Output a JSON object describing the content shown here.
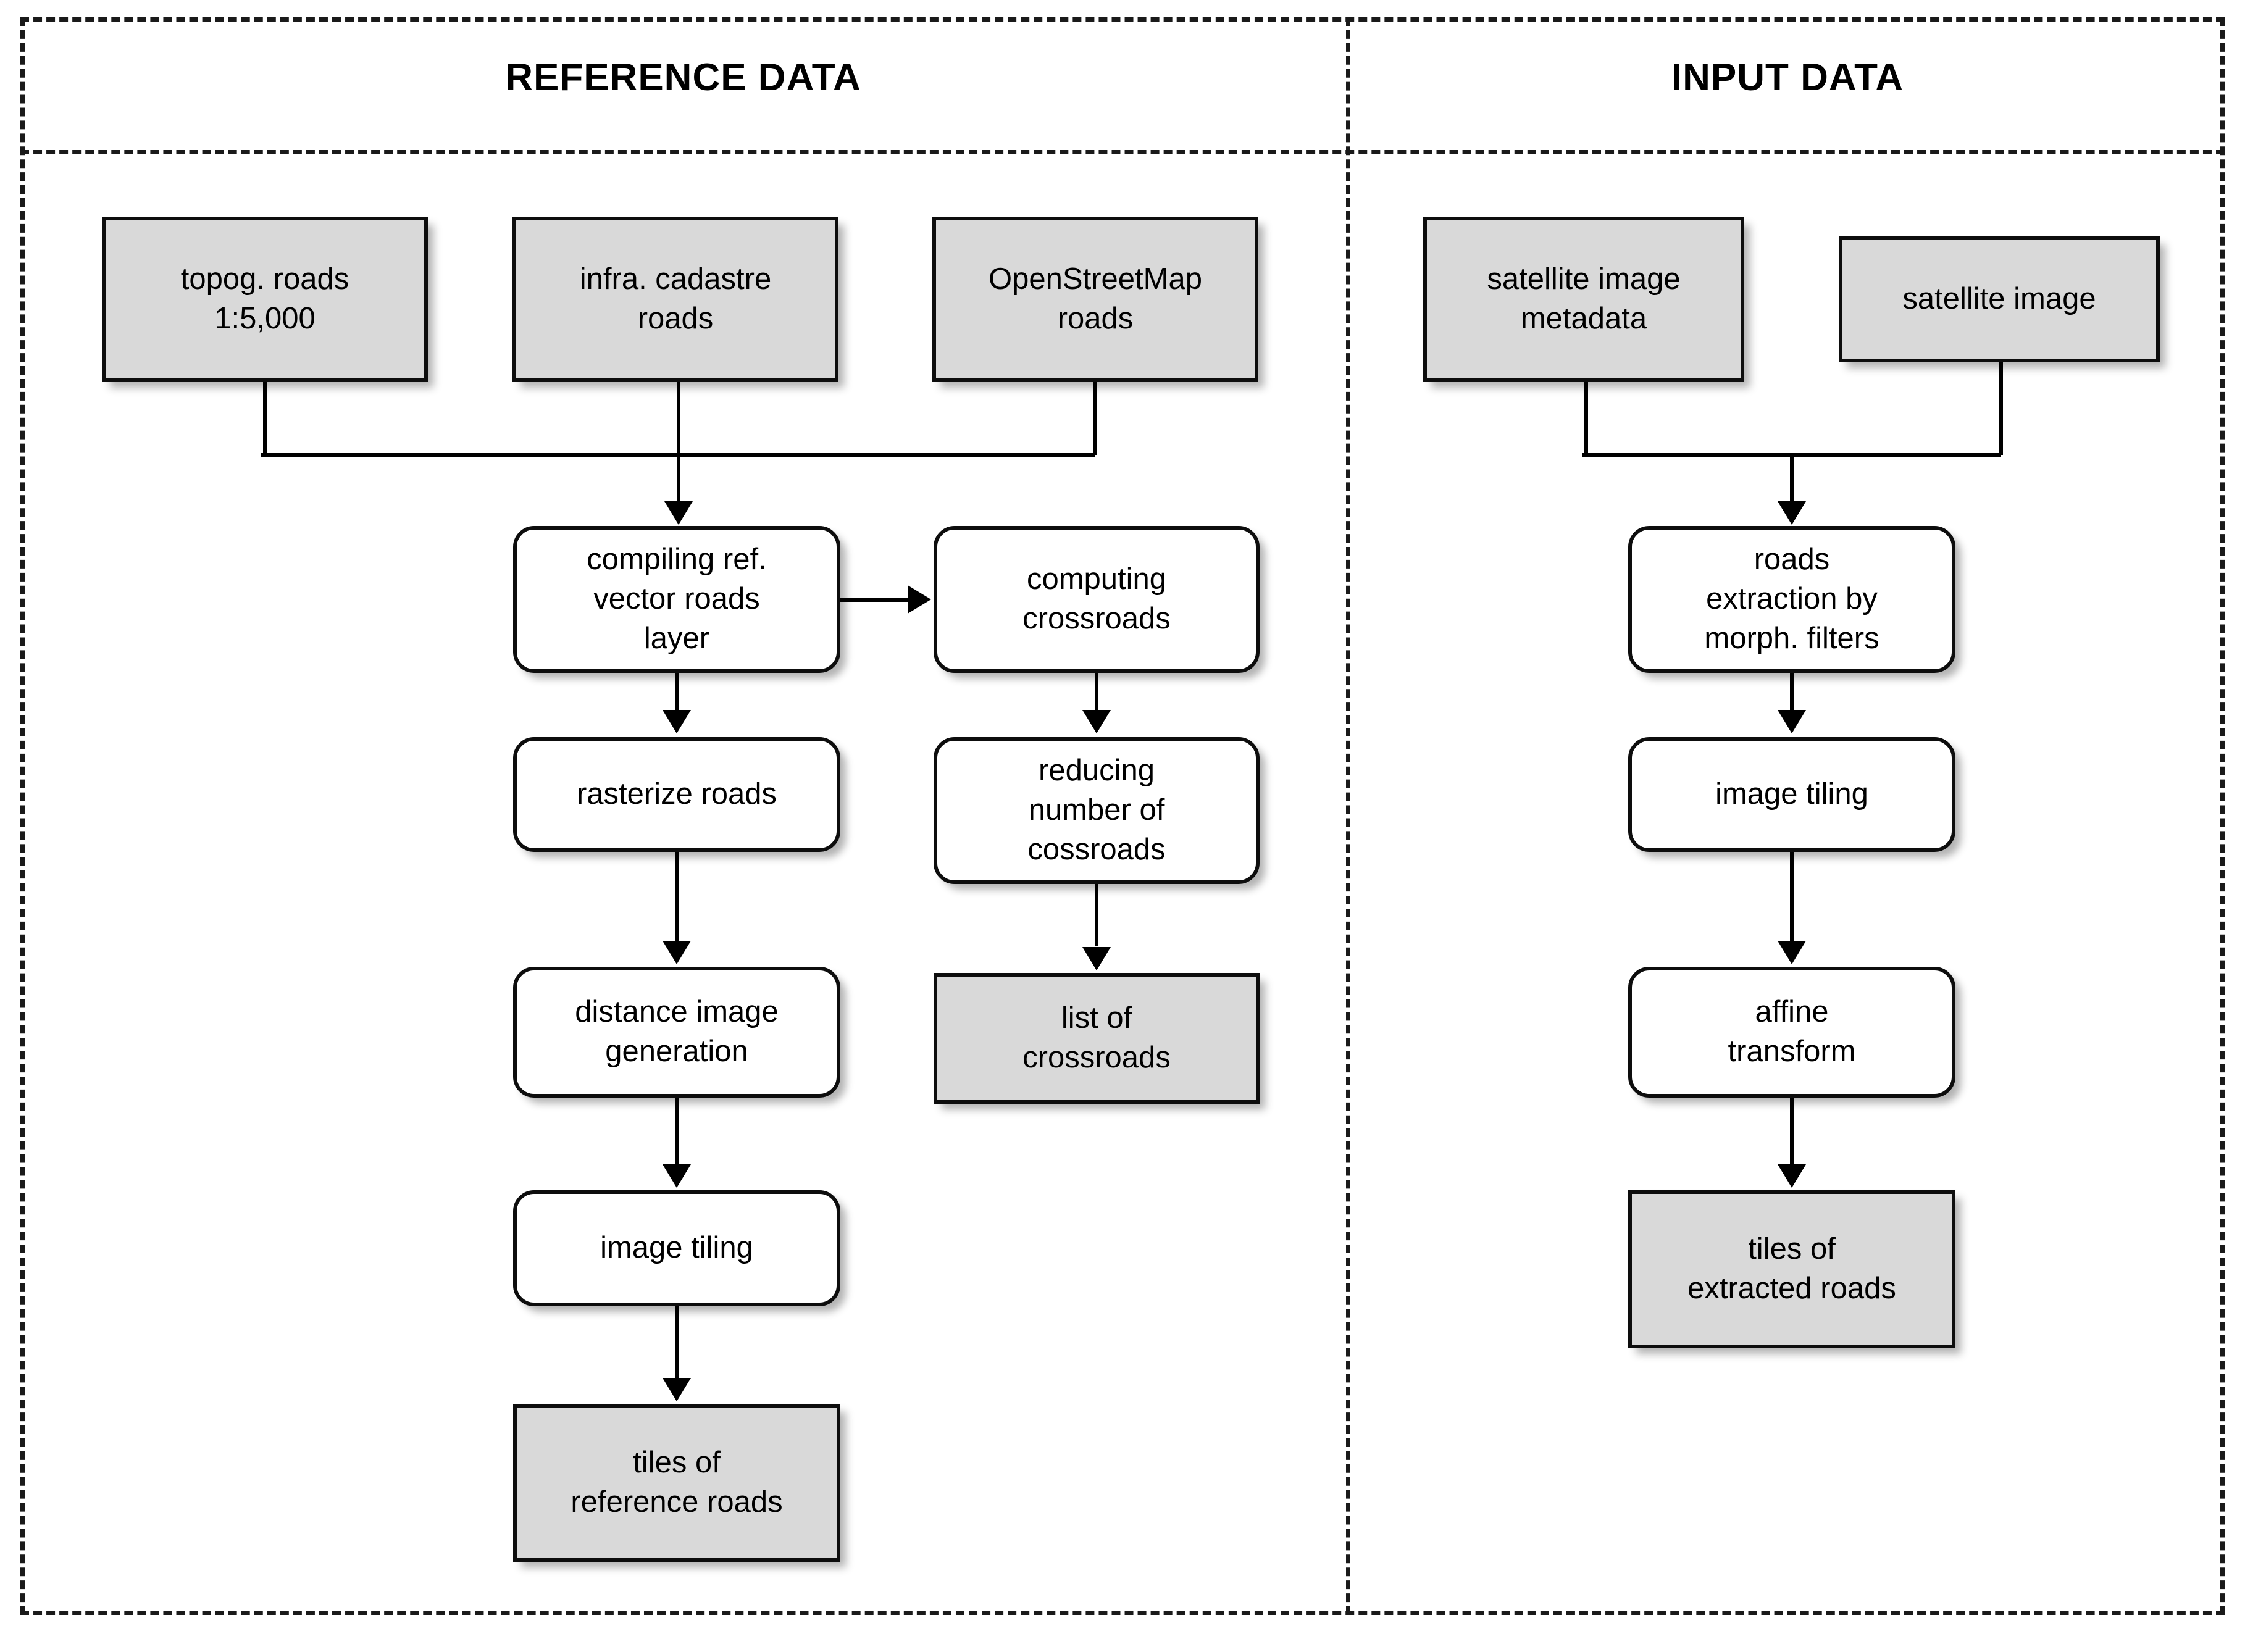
{
  "panels": {
    "reference": {
      "title": "REFERENCE DATA"
    },
    "input": {
      "title": "INPUT DATA"
    }
  },
  "colors": {
    "data_node_fill": "#d9d9d9",
    "process_node_fill": "#ffffff",
    "stroke": "#000000",
    "frame": "#1a1a1a"
  },
  "nodes": {
    "topog_roads": {
      "label": "topog. roads\n1:5,000",
      "line1": "topog. roads",
      "line2": "1:5,000",
      "line3": "",
      "type": "data"
    },
    "infra_cadastre": {
      "label": "infra. cadastre roads",
      "line1": "infra. cadastre",
      "line2": "roads",
      "line3": "",
      "type": "data"
    },
    "openstreetmap": {
      "label": "OpenStreetMap roads",
      "line1": "OpenStreetMap",
      "line2": "roads",
      "line3": "",
      "type": "data"
    },
    "compiling_ref": {
      "label": "compiling ref. vector roads layer",
      "line1": "compiling ref.",
      "line2": "vector roads",
      "line3": "layer",
      "type": "process"
    },
    "computing_cross": {
      "label": "computing crossroads",
      "line1": "computing",
      "line2": "crossroads",
      "line3": "",
      "type": "process"
    },
    "rasterize_roads": {
      "label": "rasterize roads",
      "line1": "rasterize roads",
      "line2": "",
      "line3": "",
      "type": "process"
    },
    "reducing_cross": {
      "label": "reducing number of cossroads",
      "line1": "reducing",
      "line2": "number of",
      "line3": "cossroads",
      "type": "process"
    },
    "distance_image": {
      "label": "distance image generation",
      "line1": "distance image",
      "line2": "generation",
      "line3": "",
      "type": "process"
    },
    "list_of_crossroads": {
      "label": "list of crossroads",
      "line1": "list of",
      "line2": "crossroads",
      "line3": "",
      "type": "data"
    },
    "image_tiling_left": {
      "label": "image tiling",
      "line1": "image tiling",
      "line2": "",
      "line3": "",
      "type": "process"
    },
    "tiles_reference": {
      "label": "tiles of reference roads",
      "line1": "tiles of",
      "line2": "reference roads",
      "line3": "",
      "type": "data"
    },
    "sat_metadata": {
      "label": "satellite image metadata",
      "line1": "satellite image",
      "line2": "metadata",
      "line3": "",
      "type": "data"
    },
    "sat_image": {
      "label": "satellite image",
      "line1": "satellite image",
      "line2": "",
      "line3": "",
      "type": "data"
    },
    "roads_extraction": {
      "label": "roads extraction by morph. filters",
      "line1": "roads",
      "line2": "extraction by",
      "line3": "morph. filters",
      "type": "process"
    },
    "image_tiling_right": {
      "label": "image tiling",
      "line1": "image tiling",
      "line2": "",
      "line3": "",
      "type": "process"
    },
    "affine_transform": {
      "label": "affine transform",
      "line1": "affine",
      "line2": "transform",
      "line3": "",
      "type": "process"
    },
    "tiles_extracted": {
      "label": "tiles of extracted roads",
      "line1": "tiles of",
      "line2": "extracted roads",
      "line3": "",
      "type": "data"
    }
  },
  "edges": [
    {
      "from": "topog_roads",
      "to": "compiling_ref"
    },
    {
      "from": "infra_cadastre",
      "to": "compiling_ref"
    },
    {
      "from": "openstreetmap",
      "to": "compiling_ref"
    },
    {
      "from": "compiling_ref",
      "to": "computing_cross"
    },
    {
      "from": "compiling_ref",
      "to": "rasterize_roads"
    },
    {
      "from": "computing_cross",
      "to": "reducing_cross"
    },
    {
      "from": "rasterize_roads",
      "to": "distance_image"
    },
    {
      "from": "reducing_cross",
      "to": "list_of_crossroads"
    },
    {
      "from": "distance_image",
      "to": "image_tiling_left"
    },
    {
      "from": "image_tiling_left",
      "to": "tiles_reference"
    },
    {
      "from": "sat_metadata",
      "to": "roads_extraction"
    },
    {
      "from": "sat_image",
      "to": "roads_extraction"
    },
    {
      "from": "roads_extraction",
      "to": "image_tiling_right"
    },
    {
      "from": "image_tiling_right",
      "to": "affine_transform"
    },
    {
      "from": "affine_transform",
      "to": "tiles_extracted"
    }
  ]
}
